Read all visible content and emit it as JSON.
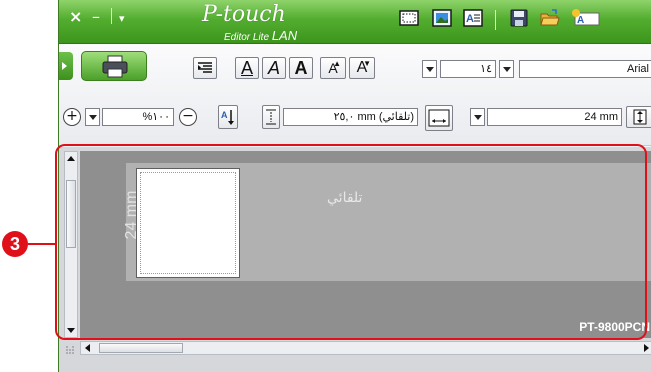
{
  "titlebar": {
    "close_glyph": "×",
    "minimize_glyph": "–",
    "menu_glyph": "▾",
    "logo": "P-touch",
    "logo_sub": "Editor Lite",
    "logo_lan": "LAN",
    "icons": [
      "frame-icon",
      "image-icon",
      "text-box-icon",
      "save-icon",
      "open-folder-icon",
      "new-label-icon"
    ]
  },
  "toolbar": {
    "align_icon": "align-right-icon",
    "format_buttons": [
      "A",
      "A",
      "A",
      "A",
      "A"
    ],
    "font_size": "١٤",
    "font_name": "Arial",
    "zoom_plus": "+",
    "zoom_value": "%١٠٠",
    "zoom_minus": "−",
    "text_direction_icon": "text-direction-icon",
    "length_value": "(تلقائي) mm ٢٥,٠",
    "tape_width": "24 mm"
  },
  "workarea": {
    "ruler_label": "24 mm",
    "tape_text": "تلقائي",
    "printer_name": "PT-9800PCN"
  },
  "callout": {
    "number": "3",
    "color": "#e0101a"
  },
  "colors": {
    "titlebar_green": "#52ad2f",
    "canvas_gray": "#8f8f8f",
    "accent_red": "#e0101a"
  }
}
